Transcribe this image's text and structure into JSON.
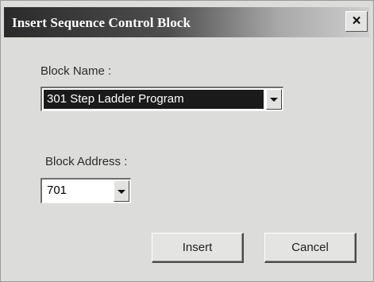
{
  "window": {
    "title": "Insert Sequence Control Block",
    "close_label": "×"
  },
  "block_name": {
    "label": "Block Name :",
    "value": "301  Step Ladder Program"
  },
  "block_address": {
    "label": "Block Address :",
    "value": "701"
  },
  "buttons": {
    "insert": "Insert",
    "cancel": "Cancel"
  }
}
